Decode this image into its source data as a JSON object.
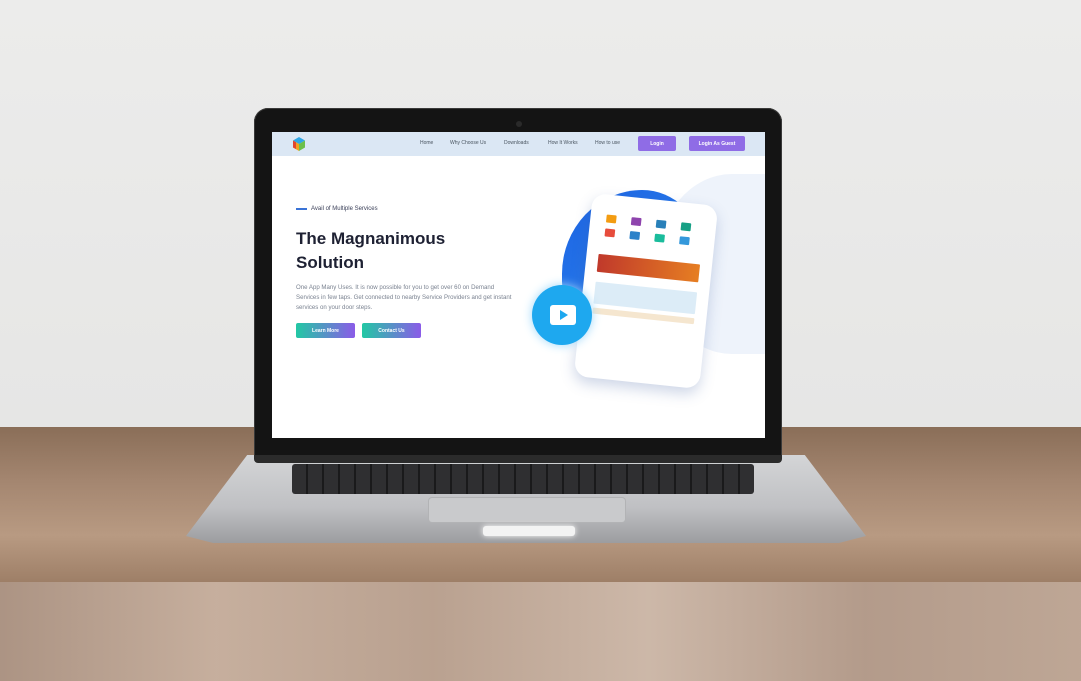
{
  "nav": {
    "links": [
      "Home",
      "Why Choose Us",
      "Downloads",
      "How It Works",
      "How to use"
    ],
    "login_label": "Login",
    "guest_label": "Login As Guest"
  },
  "hero": {
    "eyebrow": "Avail of Multiple Services",
    "headline": "The Magnanimous Solution",
    "description": "One App Many Uses. It is now possible for you to get over 60 on Demand Services in few taps. Get connected to nearby Service Providers and get instant services on your door steps.",
    "learn_more_label": "Learn More",
    "contact_label": "Contact Us"
  },
  "colors": {
    "accent_purple": "#8f6ce6",
    "cta_start": "#22c8a4",
    "cta_end": "#8b5be8",
    "blob_blue": "#1d63e2",
    "play_blue": "#1ea8ef"
  },
  "icons": [
    "cube-logo-icon",
    "play-icon"
  ]
}
